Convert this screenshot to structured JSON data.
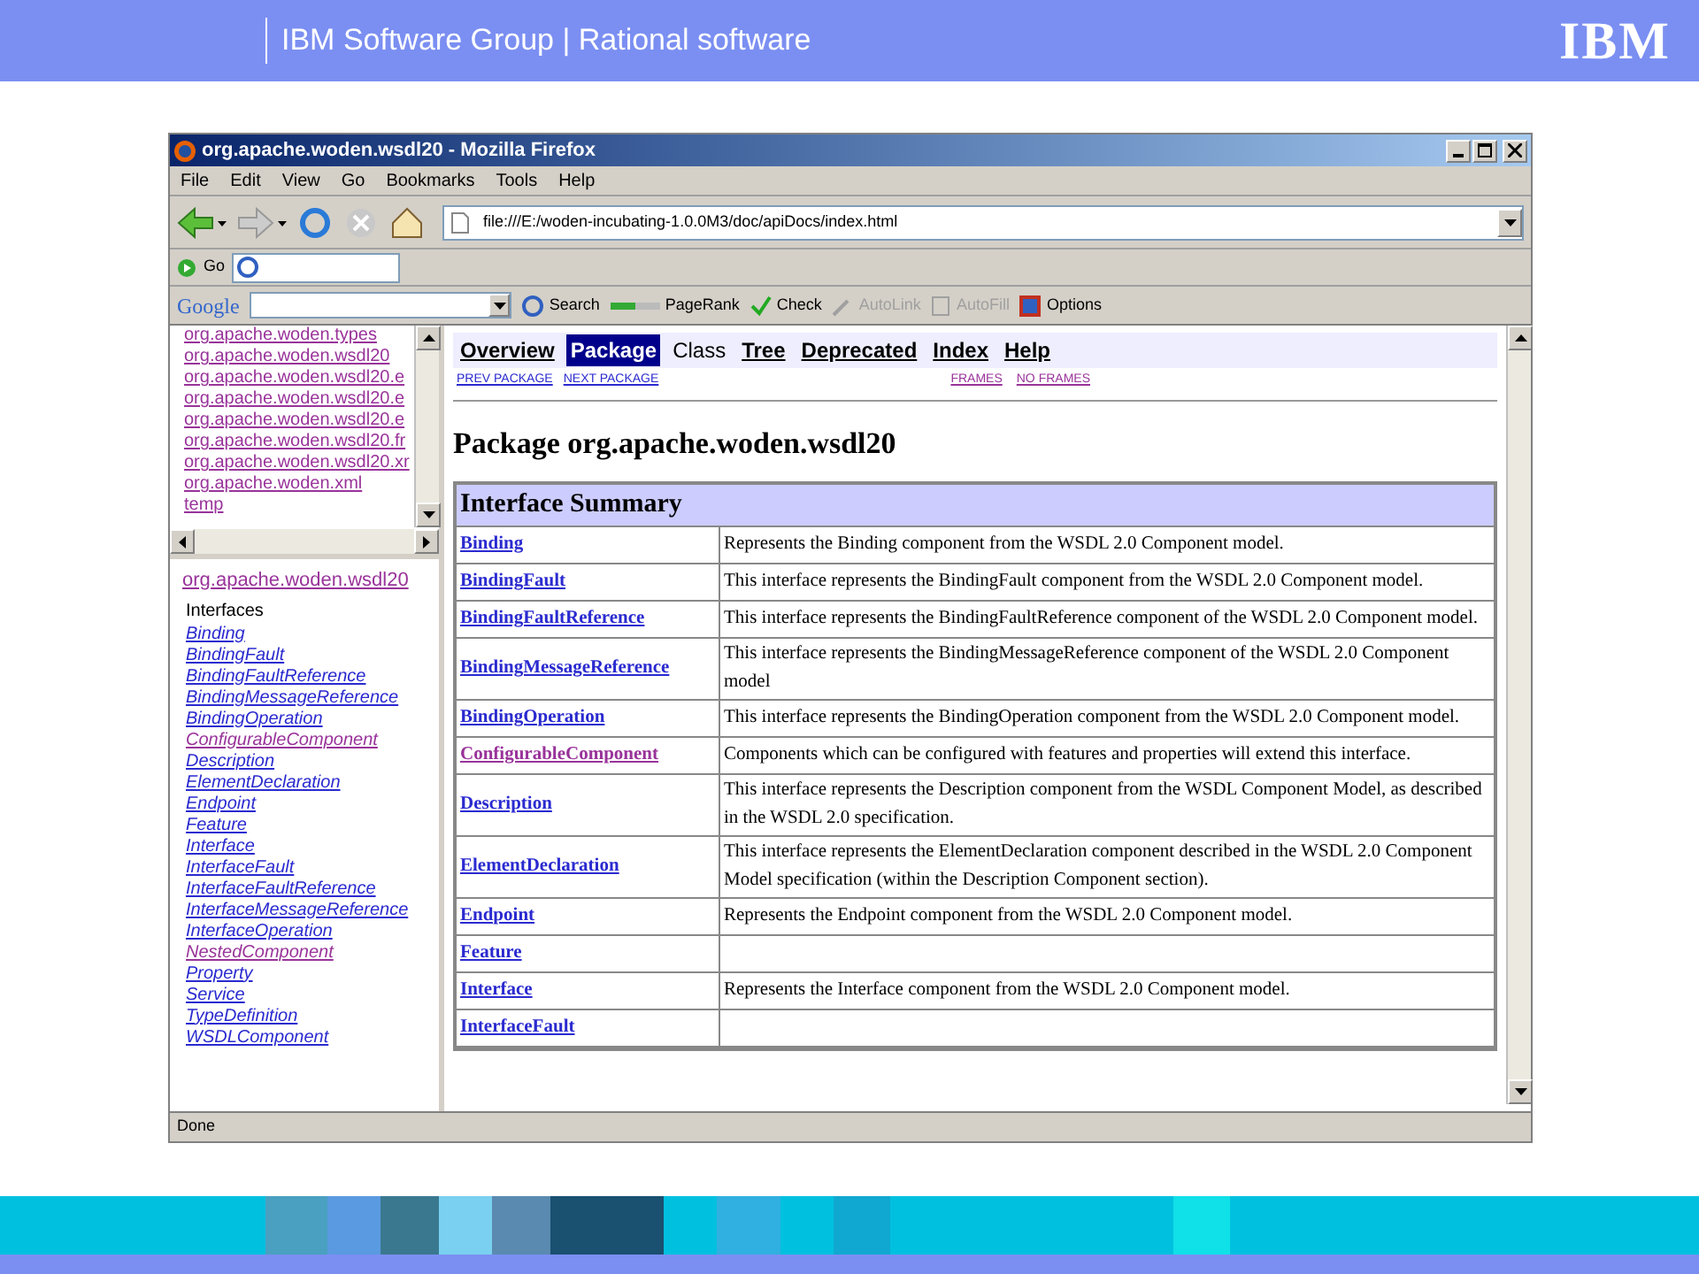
{
  "slide_header": {
    "title": "IBM Software Group | Rational software",
    "logo": "IBM"
  },
  "window": {
    "title": "org.apache.woden.wsdl20 - Mozilla Firefox"
  },
  "menu": [
    "File",
    "Edit",
    "View",
    "Go",
    "Bookmarks",
    "Tools",
    "Help"
  ],
  "address": {
    "value": "file:///E:/woden-incubating-1.0.0M3/doc/apiDocs/index.html"
  },
  "go_bar": {
    "label": "Go"
  },
  "google_toolbar": {
    "logo": "Google",
    "items": [
      {
        "kind": "search",
        "label": "Search",
        "disabled": false
      },
      {
        "kind": "pagerank",
        "label": "PageRank",
        "disabled": false
      },
      {
        "kind": "check",
        "label": "Check",
        "disabled": false
      },
      {
        "kind": "autolink",
        "label": "AutoLink",
        "disabled": true
      },
      {
        "kind": "autofill",
        "label": "AutoFill",
        "disabled": true
      },
      {
        "kind": "options",
        "label": "Options",
        "disabled": false
      }
    ]
  },
  "packages_frame": {
    "items": [
      {
        "label": "org.apache.woden.types",
        "visited": true
      },
      {
        "label": "org.apache.woden.wsdl20",
        "visited": true
      },
      {
        "label": "org.apache.woden.wsdl20.e",
        "visited": true
      },
      {
        "label": "org.apache.woden.wsdl20.e",
        "visited": true
      },
      {
        "label": "org.apache.woden.wsdl20.e",
        "visited": true
      },
      {
        "label": "org.apache.woden.wsdl20.fr",
        "visited": true
      },
      {
        "label": "org.apache.woden.wsdl20.xr",
        "visited": true
      },
      {
        "label": "org.apache.woden.xml",
        "visited": true
      },
      {
        "label": "temp",
        "visited": true
      }
    ]
  },
  "package_frame": {
    "title": "org.apache.woden.wsdl20",
    "section": "Interfaces",
    "items": [
      {
        "label": "Binding",
        "visited": false
      },
      {
        "label": "BindingFault",
        "visited": false
      },
      {
        "label": "BindingFaultReference",
        "visited": false
      },
      {
        "label": "BindingMessageReference",
        "visited": false
      },
      {
        "label": "BindingOperation",
        "visited": false
      },
      {
        "label": "ConfigurableComponent",
        "visited": true
      },
      {
        "label": "Description",
        "visited": false
      },
      {
        "label": "ElementDeclaration",
        "visited": false
      },
      {
        "label": "Endpoint",
        "visited": false
      },
      {
        "label": "Feature",
        "visited": false
      },
      {
        "label": "Interface",
        "visited": false
      },
      {
        "label": "InterfaceFault",
        "visited": false
      },
      {
        "label": "InterfaceFaultReference",
        "visited": false
      },
      {
        "label": "InterfaceMessageReference",
        "visited": false
      },
      {
        "label": "InterfaceOperation",
        "visited": false
      },
      {
        "label": "NestedComponent",
        "visited": true
      },
      {
        "label": "Property",
        "visited": false
      },
      {
        "label": "Service",
        "visited": false
      },
      {
        "label": "TypeDefinition",
        "visited": false
      },
      {
        "label": "WSDLComponent",
        "visited": false
      }
    ]
  },
  "nav": {
    "items": [
      {
        "label": "Overview",
        "kind": "link",
        "selected": false
      },
      {
        "label": "Package",
        "kind": "link",
        "selected": true
      },
      {
        "label": "Class",
        "kind": "text",
        "selected": false
      },
      {
        "label": "Tree",
        "kind": "link",
        "selected": false
      },
      {
        "label": "Deprecated",
        "kind": "link",
        "selected": false
      },
      {
        "label": "Index",
        "kind": "link",
        "selected": false
      },
      {
        "label": "Help",
        "kind": "link",
        "selected": false
      }
    ],
    "left_links": [
      {
        "label": "PREV PACKAGE",
        "visited": false
      },
      {
        "label": "NEXT PACKAGE",
        "visited": false
      }
    ],
    "right_links": [
      {
        "label": "FRAMES",
        "visited": true
      },
      {
        "label": "NO FRAMES",
        "visited": true
      }
    ]
  },
  "heading": "Package org.apache.woden.wsdl20",
  "table": {
    "title": "Interface Summary",
    "rows": [
      {
        "name": "Binding",
        "visited": false,
        "description": "Represents the Binding component from the WSDL 2.0 Component model."
      },
      {
        "name": "BindingFault",
        "visited": false,
        "description": "This interface represents the BindingFault component from the WSDL 2.0 Component model."
      },
      {
        "name": "BindingFaultReference",
        "visited": false,
        "description": "This interface represents the BindingFaultReference component of the WSDL 2.0 Component model."
      },
      {
        "name": "BindingMessageReference",
        "visited": false,
        "description": "This interface represents the BindingMessageReference component of the WSDL 2.0 Component model"
      },
      {
        "name": "BindingOperation",
        "visited": false,
        "description": "This interface represents the BindingOperation component from the WSDL 2.0 Component model."
      },
      {
        "name": "ConfigurableComponent",
        "visited": true,
        "description": "Components which can be configured with features and properties will extend this interface."
      },
      {
        "name": "Description",
        "visited": false,
        "description": "This interface represents the Description component from the WSDL Component Model, as described in the WSDL 2.0 specification."
      },
      {
        "name": "ElementDeclaration",
        "visited": false,
        "description": "This interface represents the ElementDeclaration component described in the WSDL 2.0 Component Model specification (within the Description Component section)."
      },
      {
        "name": "Endpoint",
        "visited": false,
        "description": "Represents the Endpoint component from the WSDL 2.0 Component model."
      },
      {
        "name": "Feature",
        "visited": false
      },
      {
        "name": "Interface",
        "visited": false,
        "description": "Represents the Interface component from the WSDL 2.0 Component model."
      },
      {
        "name": "InterfaceFault",
        "visited": false
      }
    ]
  },
  "status_bar": "Done"
}
